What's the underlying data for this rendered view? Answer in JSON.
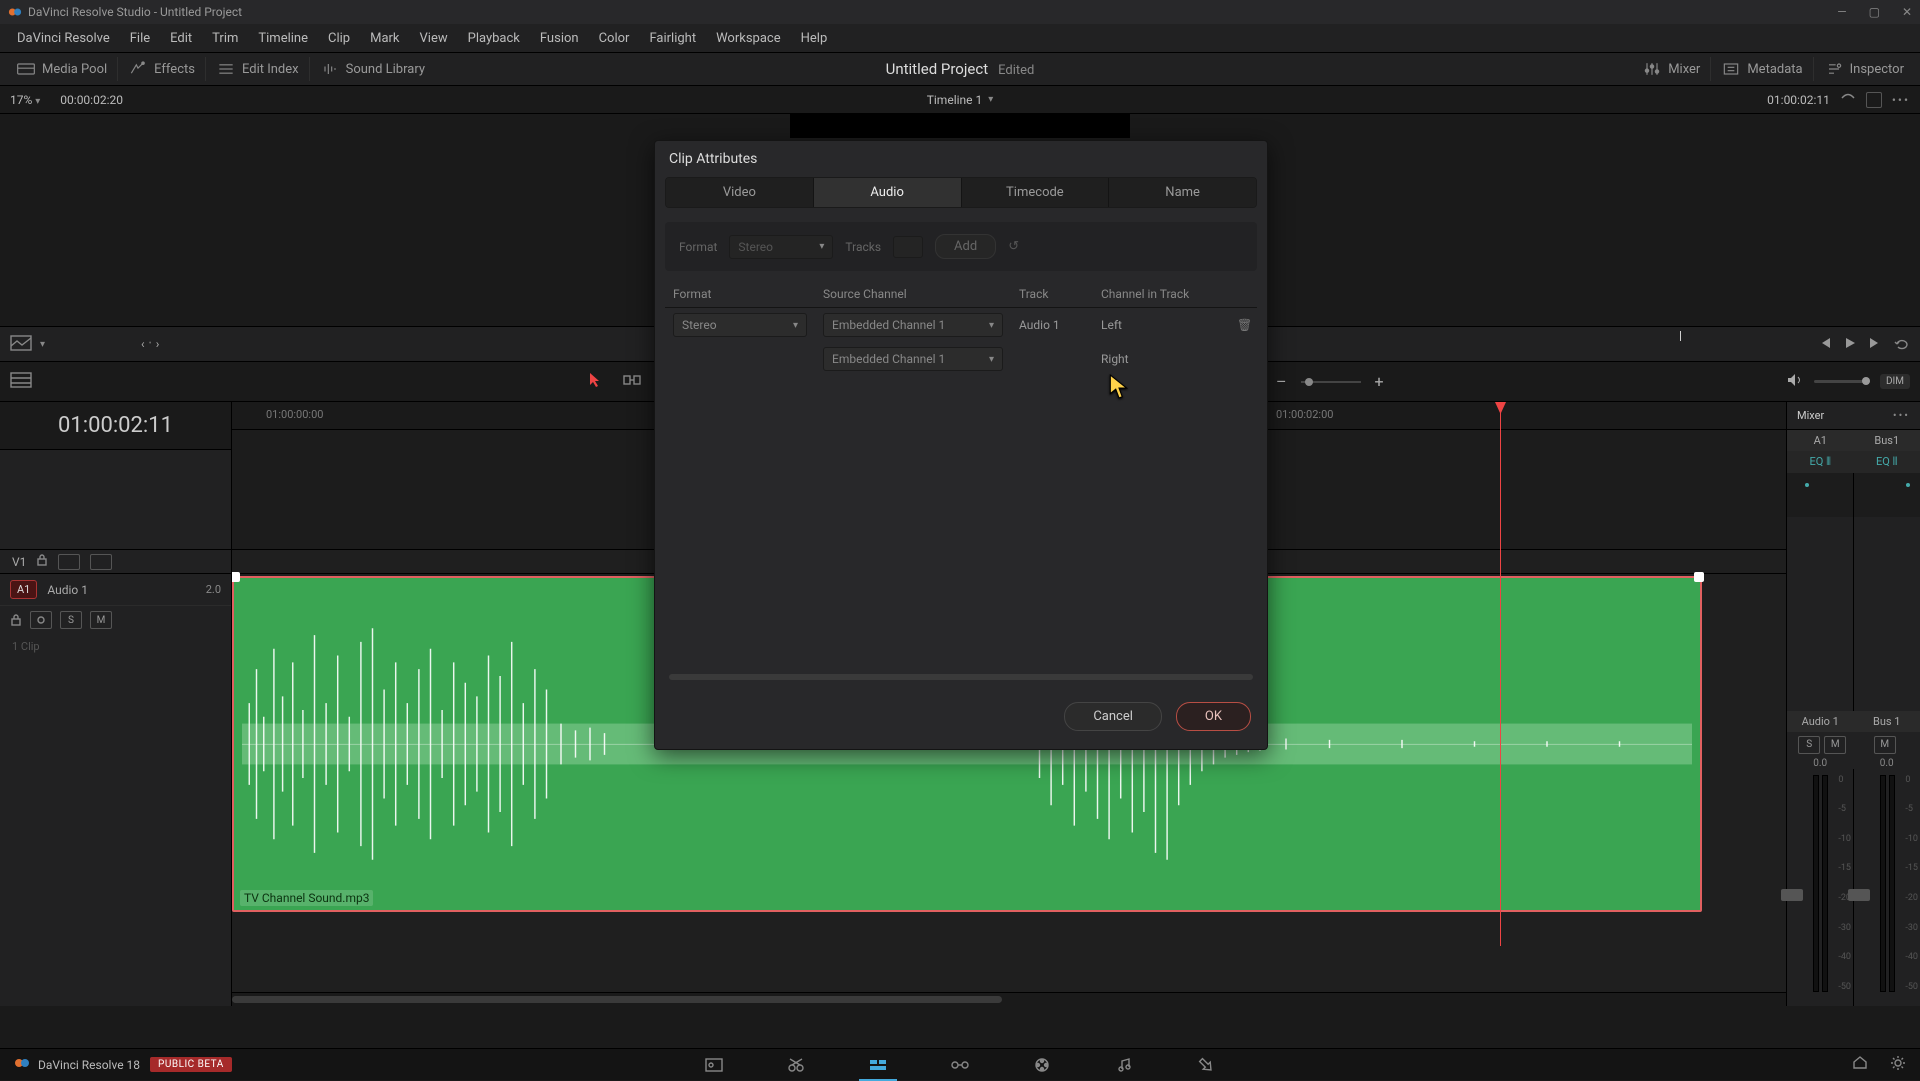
{
  "window": {
    "title": "DaVinci Resolve Studio - Untitled Project"
  },
  "menu": [
    "DaVinci Resolve",
    "File",
    "Edit",
    "Trim",
    "Timeline",
    "Clip",
    "Mark",
    "View",
    "Playback",
    "Fusion",
    "Color",
    "Fairlight",
    "Workspace",
    "Help"
  ],
  "toolbar": {
    "media_pool": "Media Pool",
    "effects": "Effects",
    "edit_index": "Edit Index",
    "sound_library": "Sound Library",
    "mixer": "Mixer",
    "metadata": "Metadata",
    "inspector": "Inspector",
    "project": "Untitled Project",
    "edited": "Edited"
  },
  "subheader": {
    "zoom": "17%",
    "tc_left": "00:00:02:20",
    "timeline_name": "Timeline 1",
    "tc_right": "01:00:02:11"
  },
  "timeline": {
    "tc_display": "01:00:02:11",
    "ruler": {
      "t0": "01:00:00:00",
      "t1": "01:00:02:00"
    },
    "video_label": "V1",
    "audio_badge": "A1",
    "audio_name": "Audio 1",
    "audio_chan": "2.0",
    "clip_count": "1 Clip",
    "clip_name": "TV Channel Sound.mp3",
    "solo": "S",
    "mute": "M"
  },
  "mixer": {
    "title": "Mixer",
    "cols": [
      {
        "short": "A1",
        "eq": "EQ ⦀",
        "name": "Audio 1",
        "db": "0.0"
      },
      {
        "short": "Bus1",
        "eq": "EQ ⦀",
        "name": "Bus 1",
        "db": "0.0"
      }
    ],
    "ticks": [
      "0",
      "-5",
      "-10",
      "-15",
      "-20",
      "-30",
      "-40",
      "-50"
    ]
  },
  "dialog": {
    "title": "Clip Attributes",
    "tabs": [
      "Video",
      "Audio",
      "Timecode",
      "Name"
    ],
    "active_tab": 1,
    "form": {
      "format_label": "Format",
      "format_value": "Stereo",
      "tracks_label": "Tracks",
      "add_label": "Add"
    },
    "columns": {
      "format": "Format",
      "source": "Source Channel",
      "track": "Track",
      "cit": "Channel in Track"
    },
    "rows": [
      {
        "format": "Stereo",
        "source": "Embedded Channel 1",
        "track": "Audio 1",
        "cit": "Left"
      },
      {
        "format": "",
        "source": "Embedded Channel 1",
        "track": "",
        "cit": "Right"
      }
    ],
    "cancel": "Cancel",
    "ok": "OK"
  },
  "bottom": {
    "app": "DaVinci Resolve 18",
    "badge": "PUBLIC BETA"
  },
  "dim_label": "DIM",
  "plus": "+",
  "dash": "–"
}
